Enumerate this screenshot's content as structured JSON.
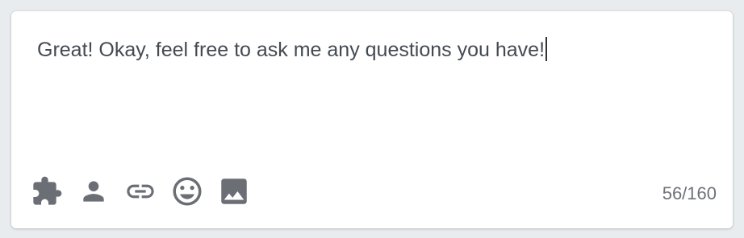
{
  "composer": {
    "text": "Great! Okay, feel free to ask me any questions you have!",
    "char_counter": "56/160"
  },
  "toolbar": {
    "icons": [
      "puzzle-piece-icon",
      "person-icon",
      "link-icon",
      "emoji-icon",
      "image-icon"
    ]
  },
  "colors": {
    "icon": "#6b6f75",
    "text": "#444a52",
    "background": "#e9ecef",
    "card": "#ffffff"
  }
}
